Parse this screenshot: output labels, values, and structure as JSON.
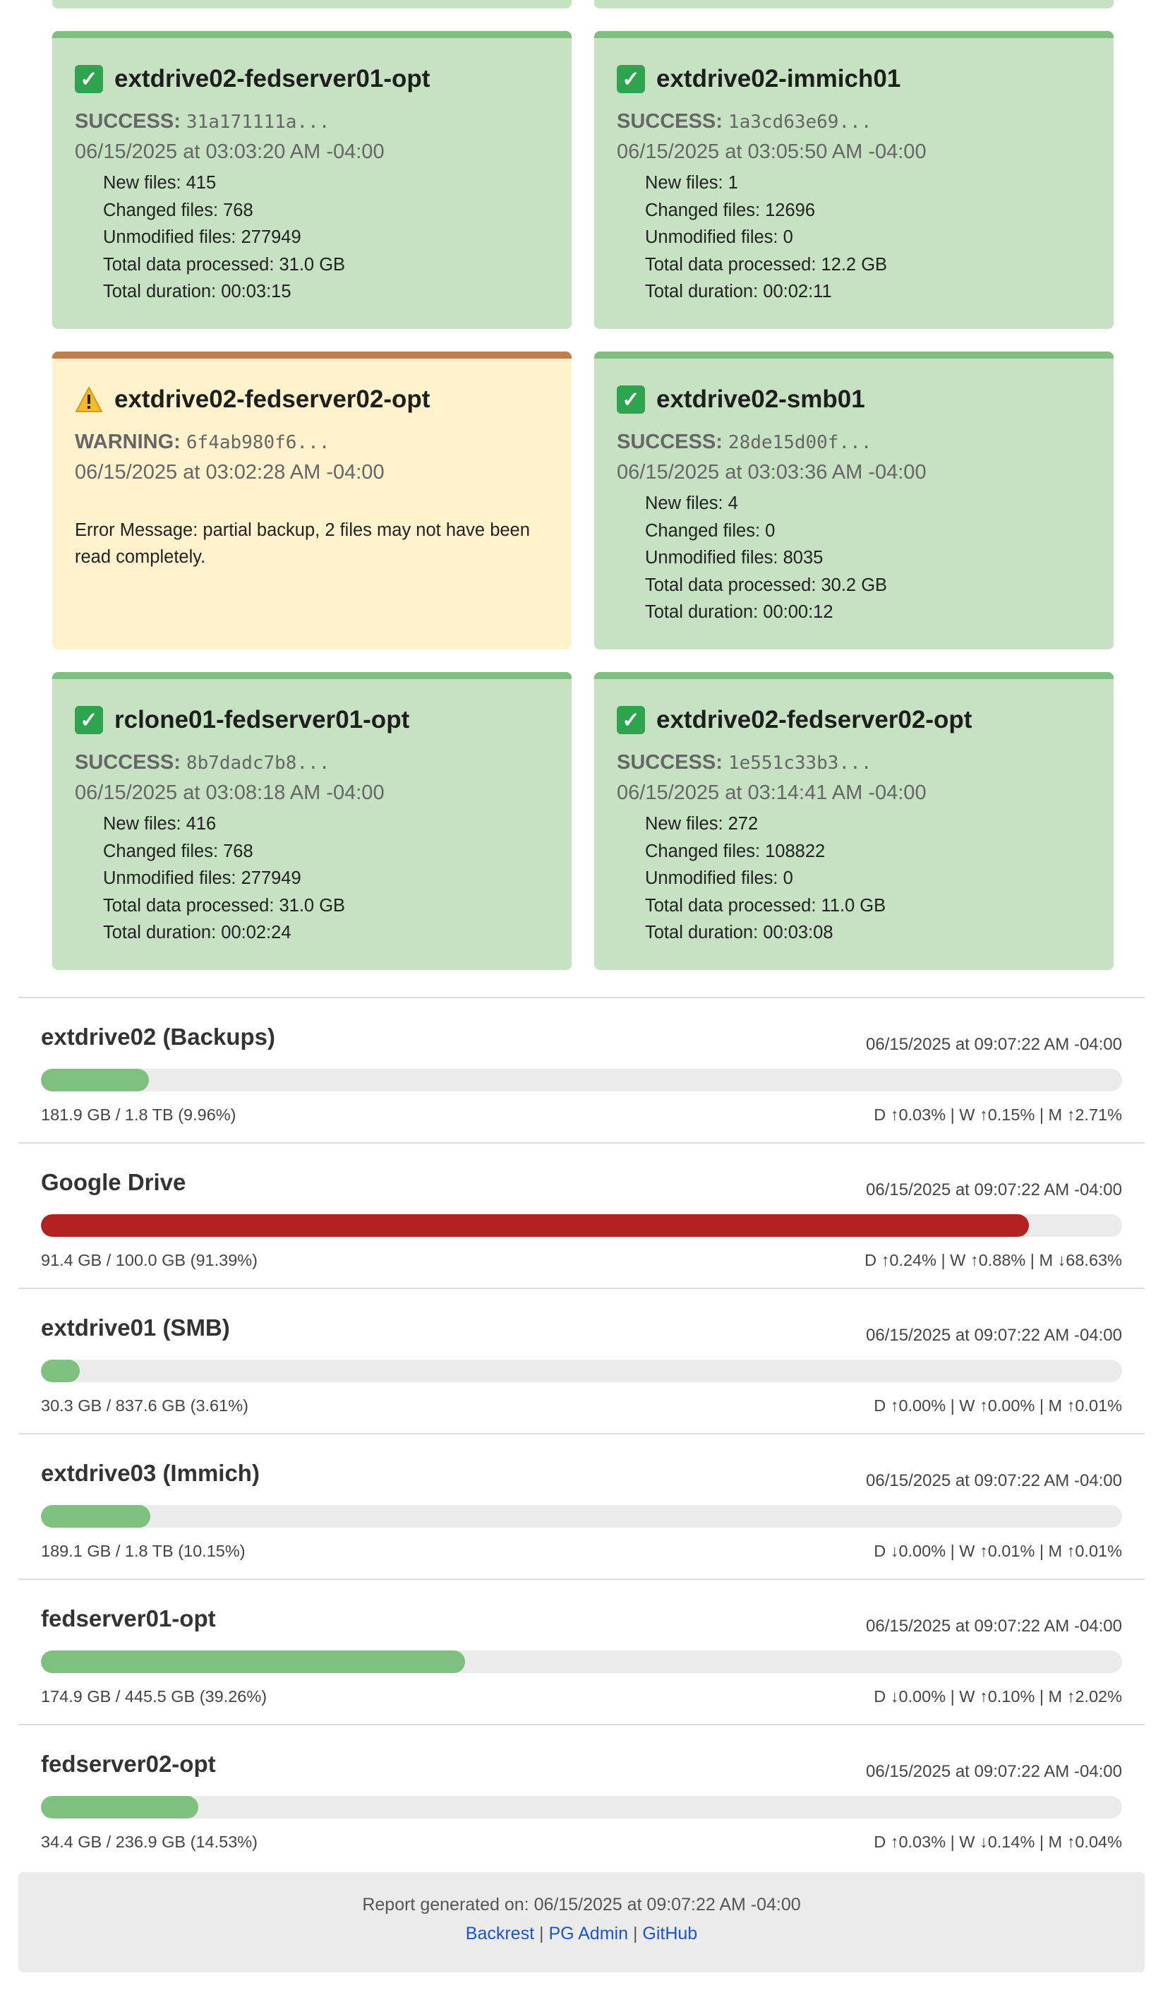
{
  "cards": [
    {
      "status": "success",
      "status_label": "SUCCESS:",
      "name": "extdrive02-fedserver01-opt",
      "hash": "31a171111a...",
      "datetime": "06/15/2025 at 03:03:20 AM -04:00",
      "stats": [
        "New files: 415",
        "Changed files: 768",
        "Unmodified files: 277949",
        "Total data processed: 31.0 GB",
        "Total duration: 00:03:15"
      ]
    },
    {
      "status": "success",
      "status_label": "SUCCESS:",
      "name": "extdrive02-immich01",
      "hash": "1a3cd63e69...",
      "datetime": "06/15/2025 at 03:05:50 AM -04:00",
      "stats": [
        "New files: 1",
        "Changed files: 12696",
        "Unmodified files: 0",
        "Total data processed: 12.2 GB",
        "Total duration: 00:02:11"
      ]
    },
    {
      "status": "warning",
      "status_label": "WARNING:",
      "name": "extdrive02-fedserver02-opt",
      "hash": "6f4ab980f6...",
      "datetime": "06/15/2025 at 03:02:28 AM -04:00",
      "error": "Error Message: partial backup, 2 files may not have been read completely."
    },
    {
      "status": "success",
      "status_label": "SUCCESS:",
      "name": "extdrive02-smb01",
      "hash": "28de15d00f...",
      "datetime": "06/15/2025 at 03:03:36 AM -04:00",
      "stats": [
        "New files: 4",
        "Changed files: 0",
        "Unmodified files: 8035",
        "Total data processed: 30.2 GB",
        "Total duration: 00:00:12"
      ]
    },
    {
      "status": "success",
      "status_label": "SUCCESS:",
      "name": "rclone01-fedserver01-opt",
      "hash": "8b7dadc7b8...",
      "datetime": "06/15/2025 at 03:08:18 AM -04:00",
      "stats": [
        "New files: 416",
        "Changed files: 768",
        "Unmodified files: 277949",
        "Total data processed: 31.0 GB",
        "Total duration: 00:02:24"
      ]
    },
    {
      "status": "success",
      "status_label": "SUCCESS:",
      "name": "extdrive02-fedserver02-opt",
      "hash": "1e551c33b3...",
      "datetime": "06/15/2025 at 03:14:41 AM -04:00",
      "stats": [
        "New files: 272",
        "Changed files: 108822",
        "Unmodified files: 0",
        "Total data processed: 11.0 GB",
        "Total duration: 00:03:08"
      ]
    }
  ],
  "storage": [
    {
      "name": "extdrive02 (Backups)",
      "timestamp": "06/15/2025 at 09:07:22 AM -04:00",
      "usage_percent": 9.96,
      "level": "normal",
      "size": "181.9 GB / 1.8 TB (9.96%)",
      "trend": "D ↑0.03% | W ↑0.15% | M ↑2.71%"
    },
    {
      "name": "Google Drive",
      "timestamp": "06/15/2025 at 09:07:22 AM -04:00",
      "usage_percent": 91.39,
      "level": "danger",
      "size": "91.4 GB / 100.0 GB (91.39%)",
      "trend": "D ↑0.24% | W ↑0.88% | M ↓68.63%"
    },
    {
      "name": "extdrive01 (SMB)",
      "timestamp": "06/15/2025 at 09:07:22 AM -04:00",
      "usage_percent": 3.61,
      "level": "normal",
      "size": "30.3 GB / 837.6 GB (3.61%)",
      "trend": "D ↑0.00% | W ↑0.00% | M ↑0.01%"
    },
    {
      "name": "extdrive03 (Immich)",
      "timestamp": "06/15/2025 at 09:07:22 AM -04:00",
      "usage_percent": 10.15,
      "level": "normal",
      "size": "189.1 GB / 1.8 TB (10.15%)",
      "trend": "D ↓0.00% | W ↑0.01% | M ↑0.01%"
    },
    {
      "name": "fedserver01-opt",
      "timestamp": "06/15/2025 at 09:07:22 AM -04:00",
      "usage_percent": 39.26,
      "level": "normal",
      "size": "174.9 GB / 445.5 GB (39.26%)",
      "trend": "D ↓0.00% | W ↑0.10% | M ↑2.02%"
    },
    {
      "name": "fedserver02-opt",
      "timestamp": "06/15/2025 at 09:07:22 AM -04:00",
      "usage_percent": 14.53,
      "level": "normal",
      "size": "34.4 GB / 236.9 GB (14.53%)",
      "trend": "D ↑0.03% | W ↓0.14% | M ↑0.04%"
    }
  ],
  "colors": {
    "success_bg": "#c6e2c3",
    "warning_bg": "#fff2cc",
    "bar_normal": "#7fbf7f",
    "bar_danger": "#b22222"
  },
  "footer": {
    "generated": "Report generated on: 06/15/2025 at 09:07:22 AM -04:00",
    "links": [
      "Backrest",
      "PG Admin",
      "GitHub"
    ],
    "separator": "|"
  }
}
